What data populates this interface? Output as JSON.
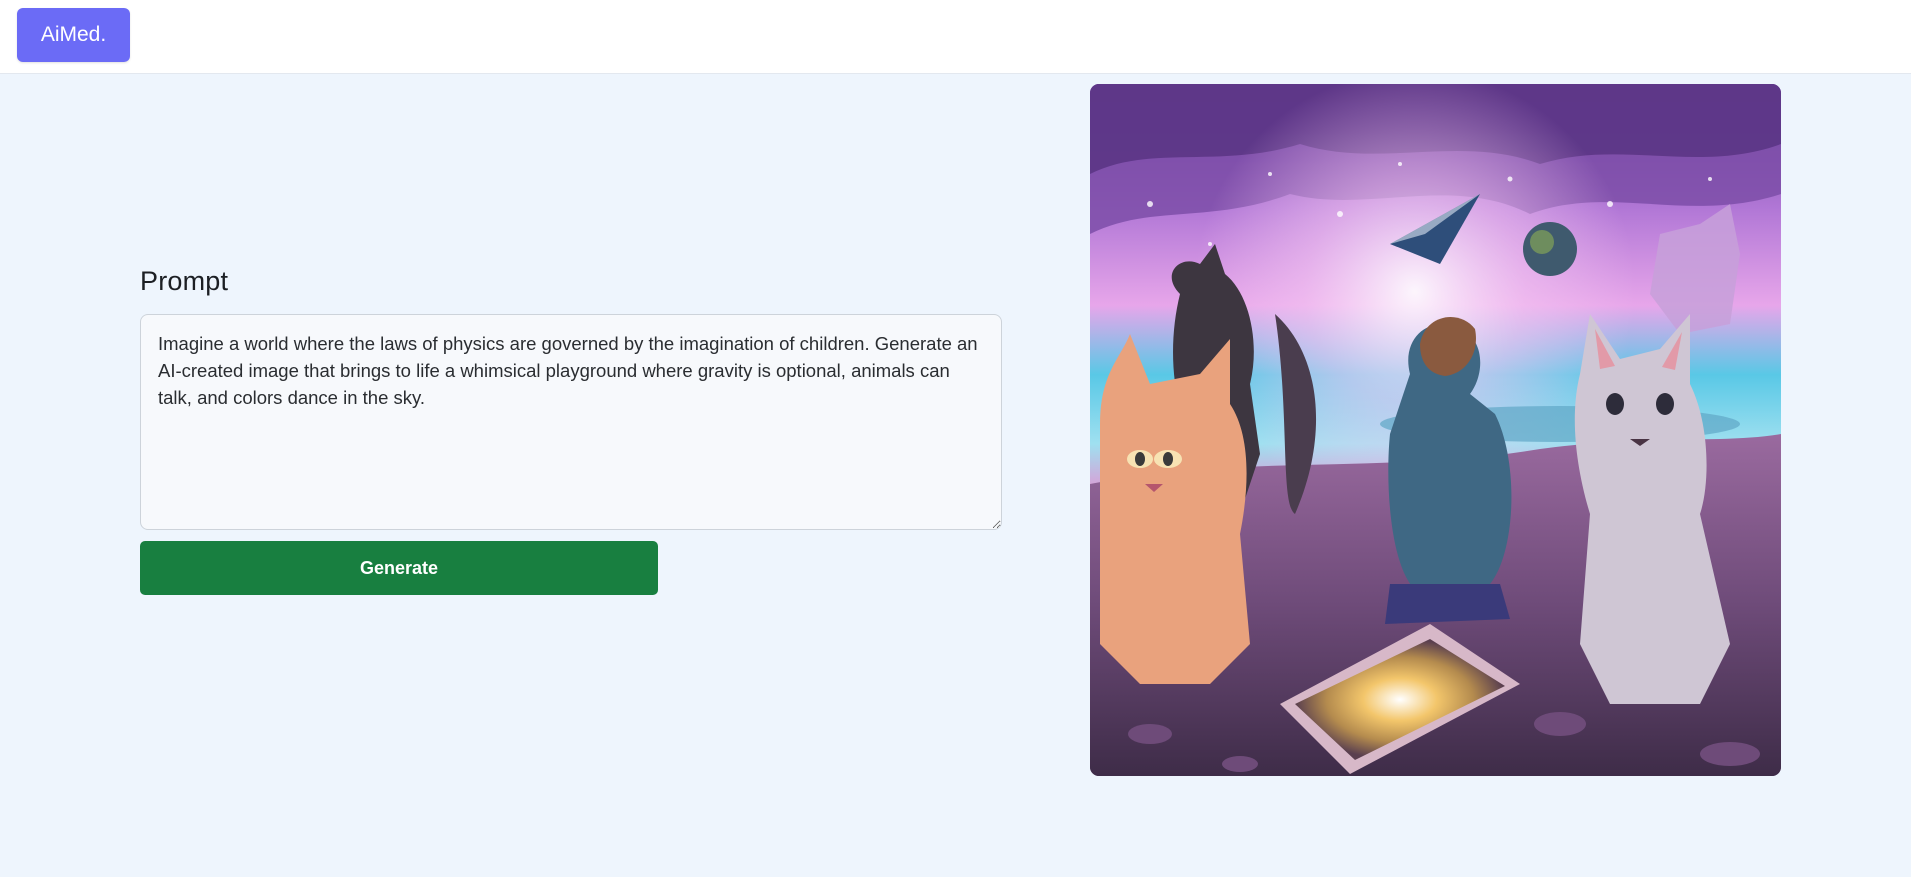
{
  "header": {
    "logo_text": "AiMed."
  },
  "form": {
    "prompt_label": "Prompt",
    "prompt_value": "Imagine a world where the laws of physics are governed by the imagination of children. Generate an AI-created image that brings to life a whimsical playground where gravity is optional, animals can talk, and colors dance in the sky.",
    "generate_label": "Generate"
  },
  "colors": {
    "logo_bg": "#6b6bf6",
    "generate_bg": "#187f40",
    "page_bg": "#eef5fd"
  }
}
